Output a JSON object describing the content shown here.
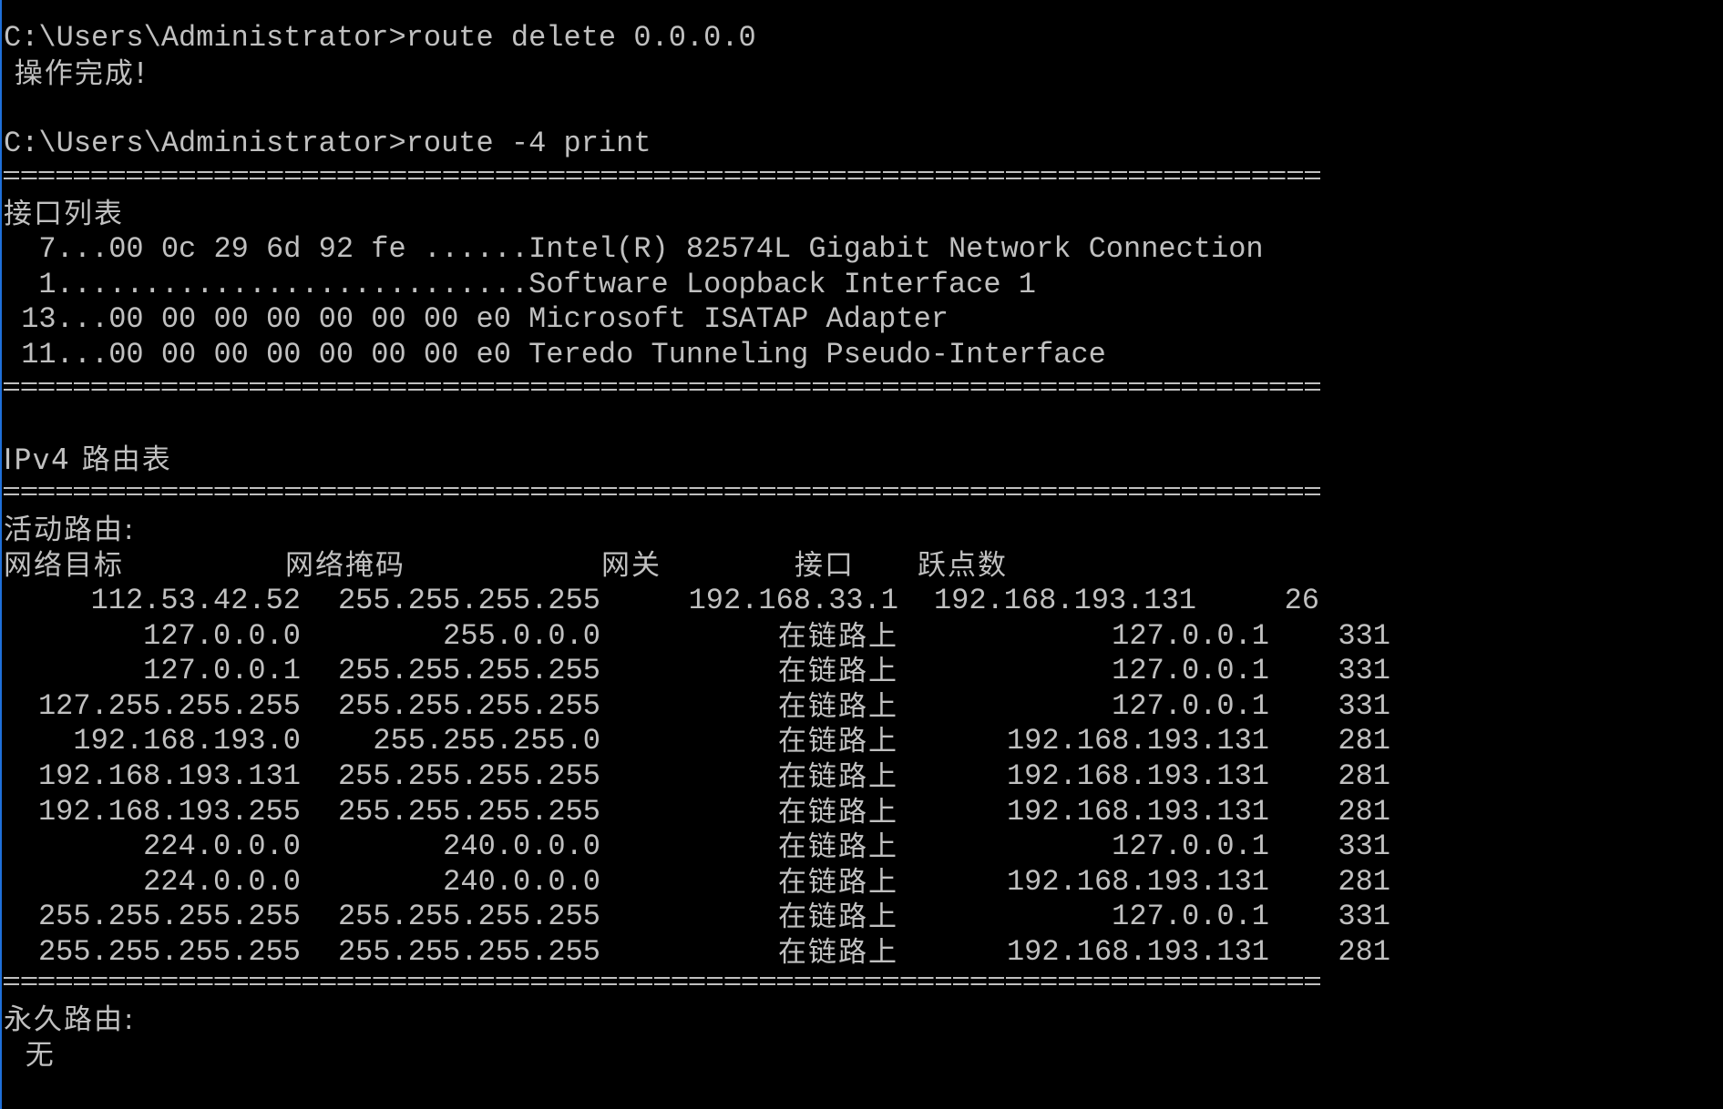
{
  "window": {
    "type": "Windows Command Prompt",
    "text_color": "#c0c0c0",
    "background": "#000000",
    "edge_accent": "#1e6fd9"
  },
  "session": {
    "cmd1": {
      "prompt": "C:\\Users\\Administrator>",
      "command": "route delete 0.0.0.0",
      "output": " 操作完成!"
    },
    "cmd2": {
      "prompt": "C:\\Users\\Administrator>",
      "command": "route -4 print"
    }
  },
  "interface_list": {
    "title": "接口列表",
    "items": [
      {
        "line": "  7...00 0c 29 6d 92 fe ......Intel(R) 82574L Gigabit Network Connection"
      },
      {
        "line": "  1...........................Software Loopback Interface 1"
      },
      {
        "line": " 13...00 00 00 00 00 00 00 e0 Microsoft ISATAP Adapter"
      },
      {
        "line": " 11...00 00 00 00 00 00 00 e0 Teredo Tunneling Pseudo-Interface"
      }
    ]
  },
  "ipv4_table": {
    "title": "IPv4 路由表",
    "active_routes_label": "活动路由:",
    "headers": {
      "destination": "网络目标",
      "netmask": "网络掩码",
      "gateway": "网关",
      "interface": "接口",
      "metric": "跃点数"
    },
    "rows": [
      {
        "destination": "112.53.42.52",
        "netmask": "255.255.255.255",
        "gateway": "192.168.33.1",
        "interface": "192.168.193.131",
        "metric": "26"
      },
      {
        "destination": "127.0.0.0",
        "netmask": "255.0.0.0",
        "gateway": "在链路上",
        "interface": "127.0.0.1",
        "metric": "331"
      },
      {
        "destination": "127.0.0.1",
        "netmask": "255.255.255.255",
        "gateway": "在链路上",
        "interface": "127.0.0.1",
        "metric": "331"
      },
      {
        "destination": "127.255.255.255",
        "netmask": "255.255.255.255",
        "gateway": "在链路上",
        "interface": "127.0.0.1",
        "metric": "331"
      },
      {
        "destination": "192.168.193.0",
        "netmask": "255.255.255.0",
        "gateway": "在链路上",
        "interface": "192.168.193.131",
        "metric": "281"
      },
      {
        "destination": "192.168.193.131",
        "netmask": "255.255.255.255",
        "gateway": "在链路上",
        "interface": "192.168.193.131",
        "metric": "281"
      },
      {
        "destination": "192.168.193.255",
        "netmask": "255.255.255.255",
        "gateway": "在链路上",
        "interface": "192.168.193.131",
        "metric": "281"
      },
      {
        "destination": "224.0.0.0",
        "netmask": "240.0.0.0",
        "gateway": "在链路上",
        "interface": "127.0.0.1",
        "metric": "331"
      },
      {
        "destination": "224.0.0.0",
        "netmask": "240.0.0.0",
        "gateway": "在链路上",
        "interface": "192.168.193.131",
        "metric": "281"
      },
      {
        "destination": "255.255.255.255",
        "netmask": "255.255.255.255",
        "gateway": "在链路上",
        "interface": "127.0.0.1",
        "metric": "331"
      },
      {
        "destination": "255.255.255.255",
        "netmask": "255.255.255.255",
        "gateway": "在链路上",
        "interface": "192.168.193.131",
        "metric": "281"
      }
    ],
    "persistent_routes_label": "永久路由:",
    "persistent_routes_value": "  无"
  }
}
